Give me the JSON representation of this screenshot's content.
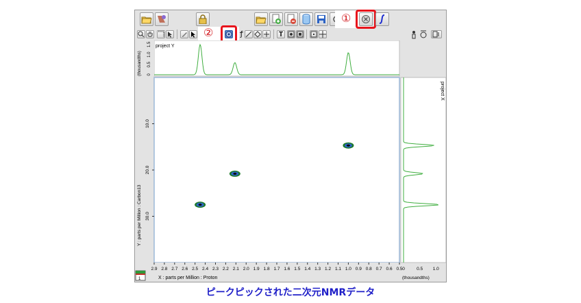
{
  "callouts": {
    "one": "①",
    "two": "②"
  },
  "toolbar": {
    "row1_icons": [
      "open-folder-icon",
      "palette-icon",
      "lock-icon",
      "open-folder-icon",
      "add-document-icon",
      "remove-document-icon",
      "cylinder-icon",
      "save-icon",
      "refresh-icon",
      "peak-pick-icon",
      "integral-icon"
    ],
    "row2_icons": [
      "zoom-icon",
      "hand-icon",
      "cursor-icon",
      "pointer-icon",
      "peak-pick-icon",
      "ruler-icon",
      "eraser-icon",
      "plus-icon",
      "text-icon",
      "grid-icon",
      "frame-icon",
      "move-icon",
      "info-icon",
      "sync-icon",
      "fit-icon"
    ],
    "row2_text": {
      "italic_f": "ƒ",
      "text_t": "T"
    }
  },
  "plot": {
    "top_label": "project Y",
    "right_label": "project X",
    "top_axis_unit": "(thousandths)",
    "top_axis_ticks": [
      "1.5",
      "1.0",
      "0.5",
      "0"
    ],
    "y_axis_label": "Y : parts per Million : Carbon13",
    "y_ticks": [
      "10.0",
      "20.0",
      "30.0"
    ],
    "x_axis_label": "X : parts per Million : Proton",
    "x_ticks": [
      "2.9",
      "2.8",
      "2.7",
      "2.6",
      "2.5",
      "2.4",
      "2.3",
      "2.2",
      "2.1",
      "2.0",
      "1.9",
      "1.8",
      "1.7",
      "1.6",
      "1.5",
      "1.4",
      "1.3",
      "1.2",
      "1.1",
      "1.0",
      "0.9",
      "0.8",
      "0.7",
      "0.6",
      "0.5"
    ],
    "right_axis_ticks": [
      "0",
      "0.5",
      "1.0"
    ],
    "right_axis_unit": "(thousandths)",
    "corner_badge": "1"
  },
  "chart_data": {
    "type": "scatter",
    "title": "",
    "xlabel": "X : parts per Million : Proton",
    "ylabel": "Y : parts per Million : Carbon13",
    "xlim": [
      2.9,
      0.5
    ],
    "ylim": [
      0,
      40
    ],
    "points": [
      {
        "x": 2.45,
        "y": 27.5
      },
      {
        "x": 2.11,
        "y": 20.8
      },
      {
        "x": 1.0,
        "y": 14.7
      }
    ],
    "projection_top": {
      "xlabel": "project Y",
      "unit": "(thousandths)",
      "peaks": [
        {
          "x": 2.45,
          "height": 1.5
        },
        {
          "x": 2.11,
          "height": 0.6
        },
        {
          "x": 1.0,
          "height": 1.1
        }
      ]
    },
    "projection_right": {
      "label": "project X",
      "unit": "(thousandths)",
      "peaks": [
        {
          "y": 14.7,
          "height": 0.95
        },
        {
          "y": 20.8,
          "height": 0.6
        },
        {
          "y": 27.5,
          "height": 1.1
        }
      ]
    }
  },
  "caption": "ピークピックされた二次元NMRデータ"
}
